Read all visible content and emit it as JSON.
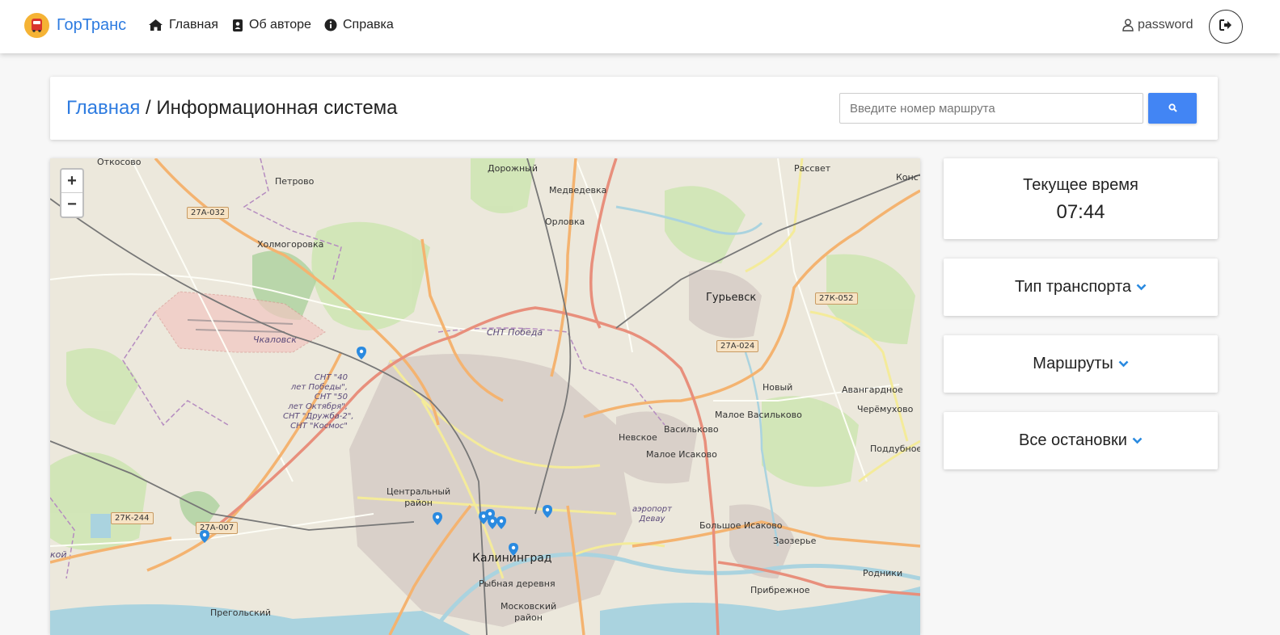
{
  "brand": {
    "name": "ГорТранс",
    "icon": "bus-icon"
  },
  "nav": [
    {
      "label": "Главная",
      "icon": "home-icon"
    },
    {
      "label": "Об авторе",
      "icon": "contact-book-icon"
    },
    {
      "label": "Справка",
      "icon": "info-icon"
    }
  ],
  "user": {
    "name": "password",
    "icon": "user-icon"
  },
  "logout": {
    "icon": "sign-out-icon"
  },
  "breadcrumb": {
    "home": "Главная",
    "separator": " / ",
    "current": "Информационная система"
  },
  "search": {
    "placeholder": "Введите номер маршрута",
    "button_icon": "search-icon"
  },
  "map": {
    "zoom_in": "+",
    "zoom_out": "−",
    "labels": {
      "otkosovo": "Откосово",
      "petrovo": "Петрово",
      "dorozhny": "Дорожный",
      "medvedevka": "Медведевка",
      "orlovka": "Орловка",
      "rassvet": "Рассвет",
      "konst": "Конст",
      "kholmogorovka": "Холмогоровка",
      "chkalovsk": "Чкаловск",
      "snt_pobeda": "СНТ Победа",
      "guryevsk": "Гурьевск",
      "snt_multi": "СНТ \"40\nлет Победы\",\nСНТ \"50\nлет Октября\",\nСНТ \"Дружба-2\",\nСНТ \"Космос\"",
      "novy": "Новый",
      "avangardnoye": "Авангардное",
      "maloye_vasilkovo": "Малое Васильково",
      "nevskoye": "Невское",
      "vasilkovo": "Васильково",
      "cheryomukhovo": "Черёмухово",
      "poddubnoye": "Поддубное",
      "maloye_isakovo": "Малое Исаково",
      "centralny": "Центральный\nрайон",
      "airport": "аэропорт\nДевау",
      "bolshoye_isakovo": "Большое Исаково",
      "zaozerye": "Заозерье",
      "kaliningrad": "Калининград",
      "rodniki": "Родники",
      "rybnaya": "Рыбная деревня",
      "pribrezhnoye": "Прибрежное",
      "moskovsky": "Московский\nрайон",
      "pregolsky": "Прегольский",
      "koy": "кой"
    },
    "shields": {
      "a032": "27А-032",
      "k052": "27К-052",
      "a024": "27А-024",
      "k244": "27К-244",
      "a007": "27А-007"
    }
  },
  "time_panel": {
    "title": "Текущее время",
    "value": "07:44"
  },
  "dropdowns": {
    "transport": "Тип транспорта",
    "routes": "Маршруты",
    "stops": "Все остановки"
  },
  "colors": {
    "accent": "#2d7be0",
    "button": "#4285f4",
    "marker": "#2a8ae0"
  }
}
